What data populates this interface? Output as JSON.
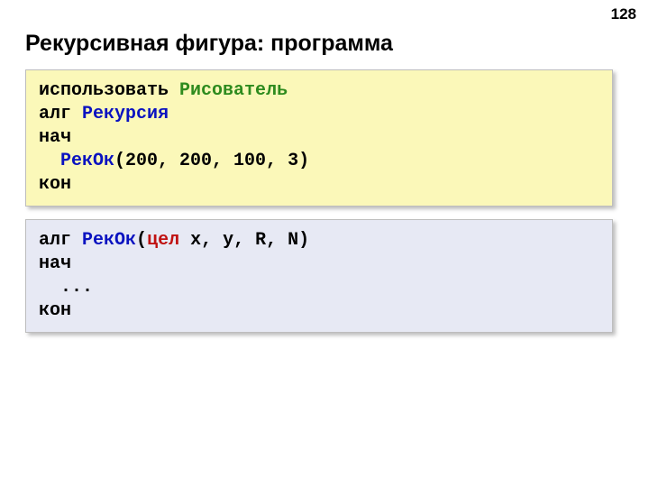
{
  "page_number": "128",
  "title": "Рекурсивная фигура: программа",
  "block1": {
    "kw_use": "использовать",
    "sp1": " ",
    "lib_name": "Рисователь",
    "nl1": "\n",
    "kw_alg": "алг",
    "sp2": " ",
    "alg_name": "Рекурсия",
    "nl2": "\n",
    "kw_begin": "нач",
    "nl3": "\n",
    "indent1": "  ",
    "call_name": "РекОк",
    "call_args": "(200, 200, 100, 3)",
    "nl4": "\n",
    "kw_end": "кон"
  },
  "block2": {
    "kw_alg": "алг",
    "sp1": " ",
    "proc_name": "РекОк",
    "paren_open": "(",
    "kw_type": "цел",
    "params_rest": " x, y, R, N)",
    "nl1": "\n",
    "kw_begin": "нач",
    "nl2": "\n",
    "indent1": "  ",
    "body": "...",
    "nl3": "\n",
    "kw_end": "кон"
  }
}
